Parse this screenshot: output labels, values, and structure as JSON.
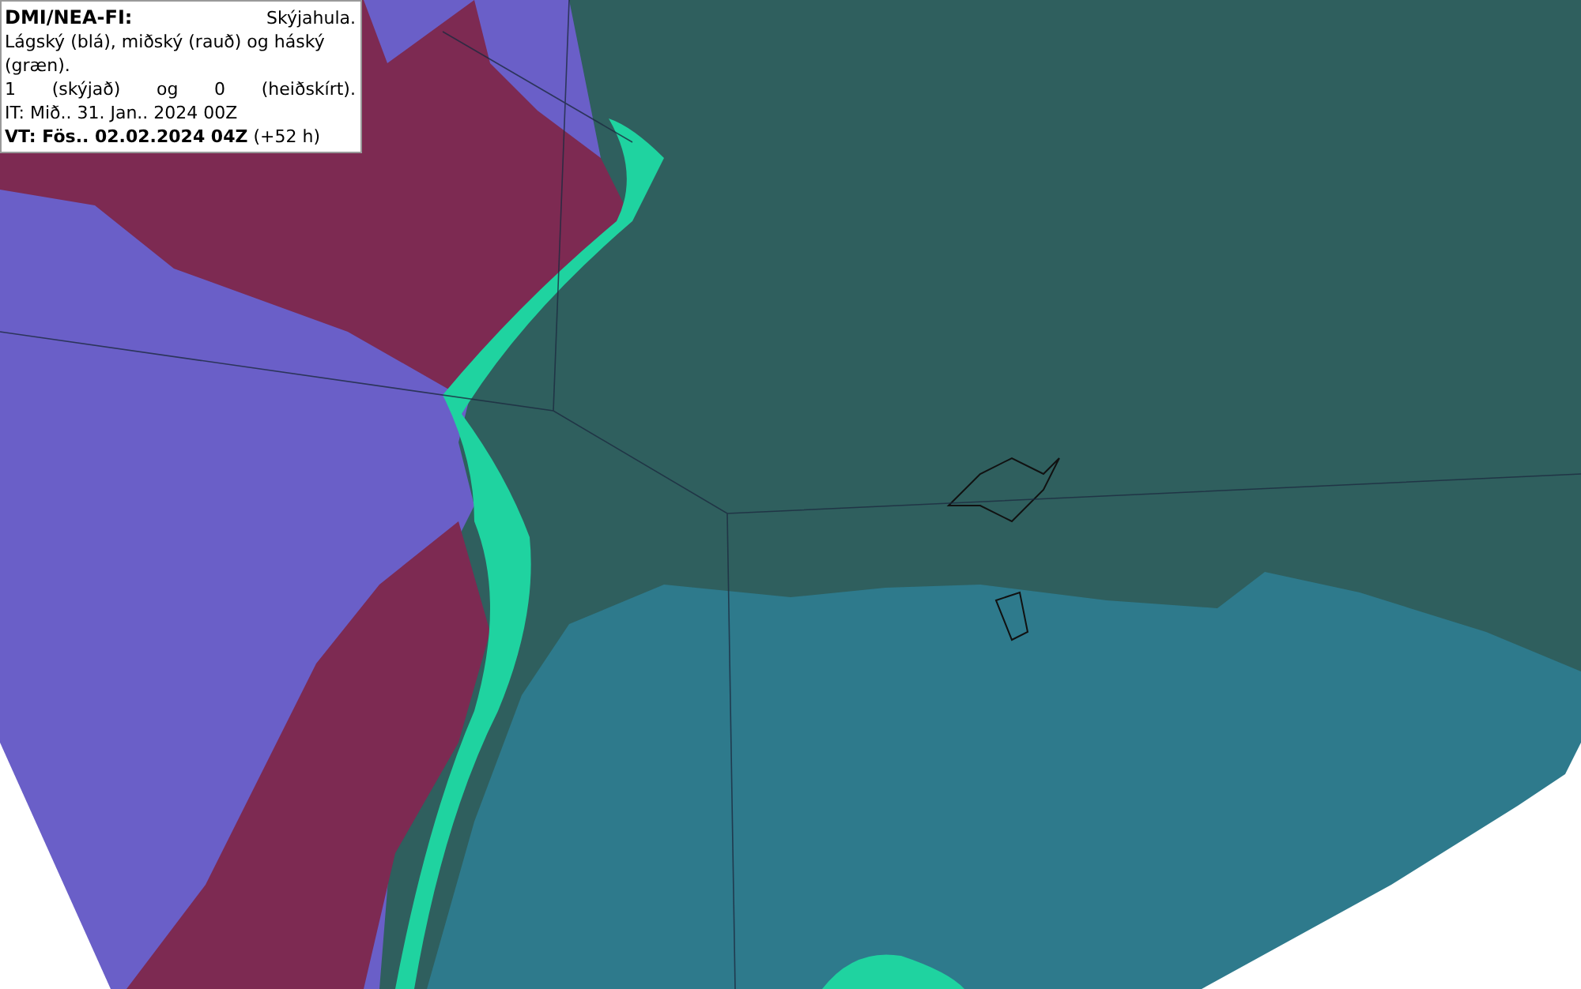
{
  "legend": {
    "title": "DMI/NEA-FI:",
    "product": "Skýjahula.",
    "description": "Lágský (blá), miðský (rauð) og háský (græn).",
    "scale": [
      "1",
      "(skýjað)",
      "og",
      "0",
      "(heiðskírt)."
    ],
    "initial_time": "IT: Mið.. 31. Jan.. 2024 00Z",
    "valid_time": "**VT: Fös.. 02.02.2024 04Z** (+52 h)"
  }
}
